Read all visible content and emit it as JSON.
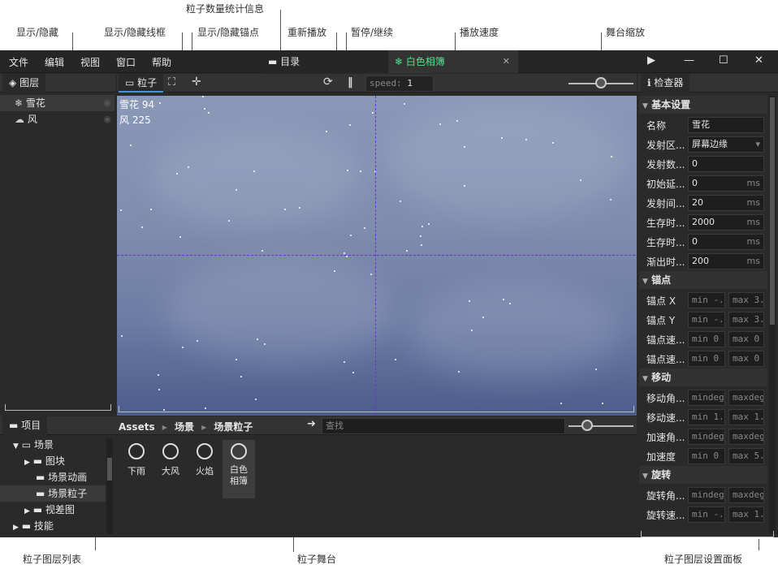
{
  "annotations": {
    "particle_stats": "粒子数量统计信息",
    "toggle_visible": "显示/隐藏",
    "toggle_wireframe": "显示/隐藏线框",
    "toggle_anchor": "显示/隐藏锚点",
    "replay": "重新播放",
    "pause_resume": "暂停/继续",
    "play_speed": "播放速度",
    "stage_zoom": "舞台缩放",
    "layer_list": "粒子图层列表",
    "stage": "粒子舞台",
    "settings_panel": "粒子图层设置面板"
  },
  "menu": [
    "文件",
    "编辑",
    "视图",
    "窗口",
    "帮助"
  ],
  "tabs": {
    "directory": "目录",
    "album": "白色相簿",
    "close": "✕"
  },
  "window_controls": {
    "play": "▶",
    "minimize": "—",
    "maximize": "☐",
    "close": "✕"
  },
  "layers_panel": {
    "title": "图层",
    "items": [
      {
        "label": "雪花",
        "icon": "snowflake-icon"
      },
      {
        "label": "风",
        "icon": "wind-icon"
      }
    ]
  },
  "stage_toolbar": {
    "particle_tab": "粒子",
    "speed_label": "speed:",
    "speed_value": "1"
  },
  "stats": [
    "雪花 94",
    "风 225"
  ],
  "project": {
    "title": "项目",
    "tree": [
      {
        "label": "场景",
        "expanded": true
      },
      {
        "label": "图块"
      },
      {
        "label": "场景动画"
      },
      {
        "label": "场景粒子",
        "selected": true
      },
      {
        "label": "视差图"
      },
      {
        "label": "技能"
      }
    ],
    "breadcrumb": [
      "Assets",
      "场景",
      "场景粒子"
    ],
    "search_placeholder": "查找",
    "assets": [
      {
        "label": "下雨"
      },
      {
        "label": "大风"
      },
      {
        "label": "火焰"
      },
      {
        "label": "白色相簿",
        "selected": true
      }
    ]
  },
  "inspector": {
    "title": "检查器",
    "sections": {
      "basic": "基本设置",
      "anchor": "锚点",
      "move": "移动",
      "rotate": "旋转"
    },
    "basic": [
      {
        "label": "名称",
        "value": "雪花",
        "unit": ""
      },
      {
        "label": "发射区...",
        "value": "屏幕边缘",
        "unit": "▾"
      },
      {
        "label": "发射数...",
        "value": "0",
        "unit": ""
      },
      {
        "label": "初始延...",
        "value": "0",
        "unit": "ms"
      },
      {
        "label": "发射间...",
        "value": "20",
        "unit": "ms"
      },
      {
        "label": "生存时...",
        "value": "2000",
        "unit": "ms"
      },
      {
        "label": "生存时...",
        "value": "0",
        "unit": "ms"
      },
      {
        "label": "渐出时...",
        "value": "200",
        "unit": "ms"
      }
    ],
    "anchor": [
      {
        "label": "锚点 X",
        "min": "min -.",
        "max": "max 3."
      },
      {
        "label": "锚点 Y",
        "min": "min -.",
        "max": "max 3."
      },
      {
        "label": "锚点速...",
        "min": "min 0",
        "max": "max 0"
      },
      {
        "label": "锚点速...",
        "min": "min 0",
        "max": "max 0"
      }
    ],
    "move": [
      {
        "label": "移动角...",
        "min": "mindeg",
        "max": "maxdeg"
      },
      {
        "label": "移动速...",
        "min": "min 1.",
        "max": "max 1."
      },
      {
        "label": "加速角...",
        "min": "mindeg",
        "max": "maxdeg"
      },
      {
        "label": "加速度",
        "min": "min 0",
        "max": "max 5."
      }
    ],
    "rotate": [
      {
        "label": "旋转角...",
        "min": "mindeg",
        "max": "maxdeg"
      },
      {
        "label": "旋转速...",
        "min": "min -.",
        "max": "max 1."
      }
    ]
  },
  "colors": {
    "accent_green": "#4fe38a",
    "panel_bg": "#2a2a2a",
    "guide": "#6a35c8"
  }
}
